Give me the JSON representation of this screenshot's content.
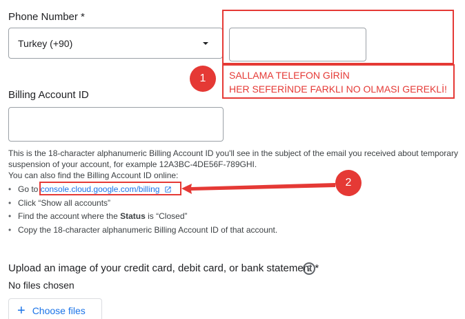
{
  "phone": {
    "label": "Phone Number *",
    "country_value": "Turkey (+90)",
    "number_value": ""
  },
  "billing": {
    "label": "Billing Account ID",
    "value": "",
    "help_line1": "This is the 18-character alphanumeric Billing Account ID you'll see in the subject of the email you received about temporary",
    "help_line2": "suspension of your account, for example 12A3BC-4DE56F-789GHI.",
    "help_line3": "You can also find the Billing Account ID online:",
    "bullets": {
      "goto_prefix": "Go to",
      "goto_link": "console.cloud.google.com/billing",
      "show_all": "Click “Show all accounts”",
      "find_prefix": "Find the account where the",
      "find_bold": "Status",
      "find_suffix": "is “Closed”",
      "copy": "Copy the 18-character alphanumeric Billing Account ID of that account."
    }
  },
  "upload": {
    "label": "Upload an image of your credit card, debit card, or bank statement *",
    "status": "No files chosen",
    "button_label": "Choose files"
  },
  "annotations": {
    "marker1": "1",
    "marker2": "2",
    "note_line1": "SALLAMA TELEFON GİRİN",
    "note_line2": "HER SEFERİNDE FARKLI NO OLMASI GEREKLİ!",
    "color": "#e53935"
  },
  "colors": {
    "link": "#1a73e8",
    "border": "#9aa0a6"
  }
}
